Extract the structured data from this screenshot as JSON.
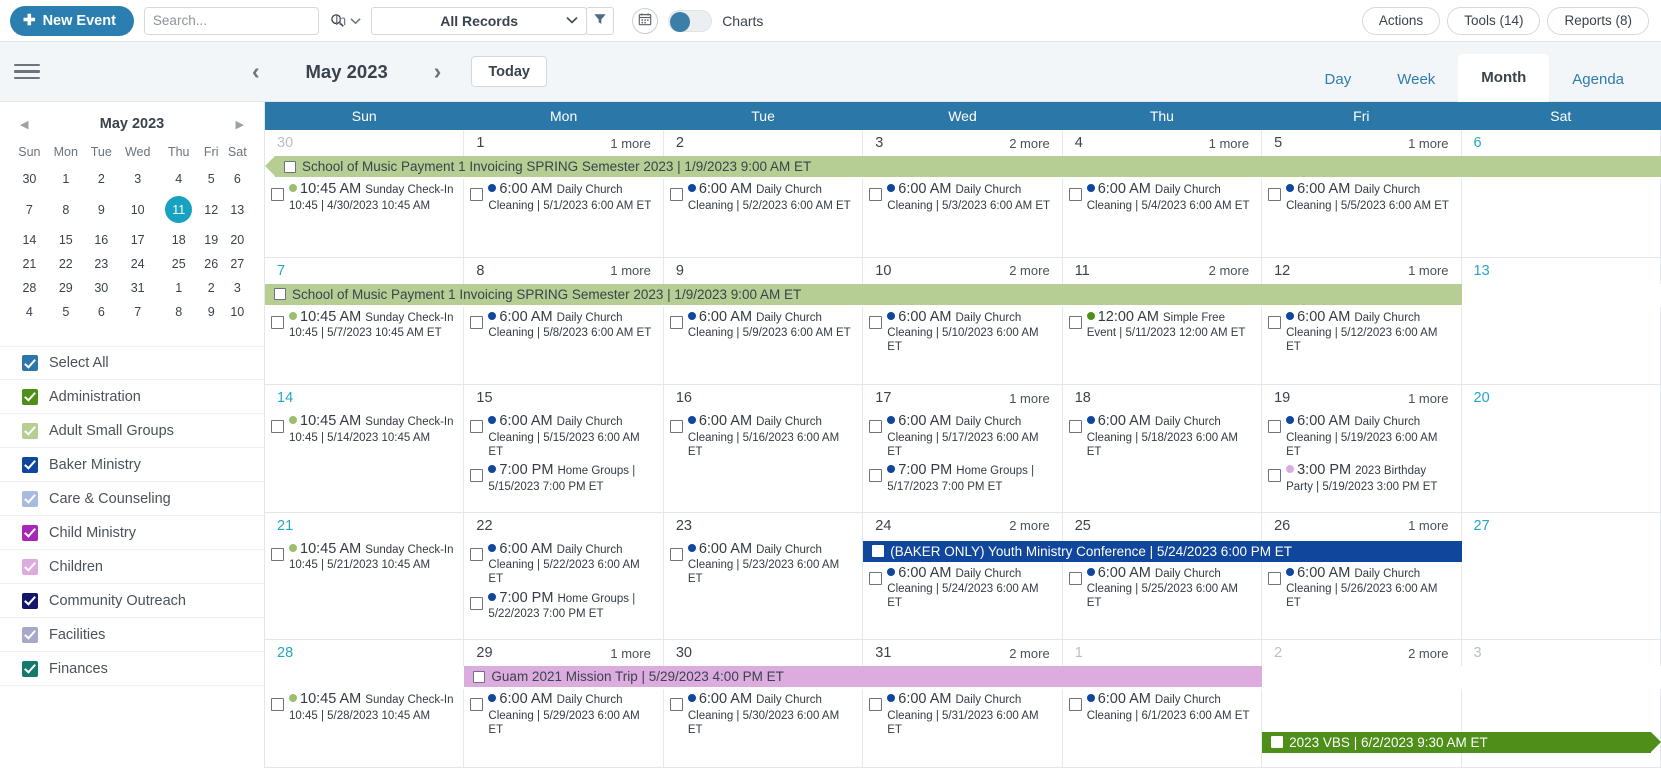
{
  "toolbar": {
    "new_event_label": "New Event",
    "search_placeholder": "Search...",
    "search_value": "",
    "in_label": "In",
    "records_label": "All Records",
    "charts_label": "Charts",
    "actions_label": "Actions",
    "tools_label": "Tools (14)",
    "reports_label": "Reports (8)"
  },
  "subbar": {
    "month_title": "May 2023",
    "today_label": "Today",
    "tabs": [
      {
        "label": "Day",
        "active": false
      },
      {
        "label": "Week",
        "active": false
      },
      {
        "label": "Month",
        "active": true
      },
      {
        "label": "Agenda",
        "active": false
      }
    ]
  },
  "mini_calendar": {
    "title": "May 2023",
    "dow": [
      "Sun",
      "Mon",
      "Tue",
      "Wed",
      "Thu",
      "Fri",
      "Sat"
    ],
    "selected": 11,
    "weeks": [
      [
        {
          "d": "30",
          "t": "muted"
        },
        {
          "d": "1",
          "t": ""
        },
        {
          "d": "2",
          "t": ""
        },
        {
          "d": "3",
          "t": ""
        },
        {
          "d": "4",
          "t": ""
        },
        {
          "d": "5",
          "t": ""
        },
        {
          "d": "6",
          "t": "wknd"
        }
      ],
      [
        {
          "d": "7",
          "t": "wknd"
        },
        {
          "d": "8",
          "t": ""
        },
        {
          "d": "9",
          "t": ""
        },
        {
          "d": "10",
          "t": ""
        },
        {
          "d": "11",
          "t": "sel"
        },
        {
          "d": "12",
          "t": ""
        },
        {
          "d": "13",
          "t": "wknd"
        }
      ],
      [
        {
          "d": "14",
          "t": "wknd"
        },
        {
          "d": "15",
          "t": ""
        },
        {
          "d": "16",
          "t": ""
        },
        {
          "d": "17",
          "t": ""
        },
        {
          "d": "18",
          "t": ""
        },
        {
          "d": "19",
          "t": ""
        },
        {
          "d": "20",
          "t": "wknd"
        }
      ],
      [
        {
          "d": "21",
          "t": "wknd"
        },
        {
          "d": "22",
          "t": ""
        },
        {
          "d": "23",
          "t": ""
        },
        {
          "d": "24",
          "t": ""
        },
        {
          "d": "25",
          "t": ""
        },
        {
          "d": "26",
          "t": ""
        },
        {
          "d": "27",
          "t": "wknd"
        }
      ],
      [
        {
          "d": "28",
          "t": "wknd"
        },
        {
          "d": "29",
          "t": ""
        },
        {
          "d": "30",
          "t": ""
        },
        {
          "d": "31",
          "t": ""
        },
        {
          "d": "1",
          "t": "muted"
        },
        {
          "d": "2",
          "t": "muted"
        },
        {
          "d": "3",
          "t": "muted"
        }
      ],
      [
        {
          "d": "4",
          "t": "muted"
        },
        {
          "d": "5",
          "t": "muted"
        },
        {
          "d": "6",
          "t": "muted"
        },
        {
          "d": "7",
          "t": "muted"
        },
        {
          "d": "8",
          "t": "muted"
        },
        {
          "d": "9",
          "t": "muted"
        },
        {
          "d": "10",
          "t": "muted"
        }
      ]
    ]
  },
  "filters": [
    {
      "label": "Select All",
      "color": "#2b78a8"
    },
    {
      "label": "Administration",
      "color": "#4d8f18"
    },
    {
      "label": "Adult Small Groups",
      "color": "#b6ce93"
    },
    {
      "label": "Baker Ministry",
      "color": "#10469b"
    },
    {
      "label": "Care & Counseling",
      "color": "#a7bcdf"
    },
    {
      "label": "Child Ministry",
      "color": "#a927b7"
    },
    {
      "label": "Children",
      "color": "#dcacdf"
    },
    {
      "label": "Community Outreach",
      "color": "#13166b"
    },
    {
      "label": "Facilities",
      "color": "#a8a8cb"
    },
    {
      "label": "Finances",
      "color": "#137a6c"
    }
  ],
  "calendar": {
    "dow": [
      "Sun",
      "Mon",
      "Tue",
      "Wed",
      "Thu",
      "Fri",
      "Sat"
    ],
    "colors": {
      "green_bar": "#b6ce93",
      "blue_bar": "#10469b",
      "pink_bar": "#dcacdf",
      "vbs_green": "#4d8f18",
      "blue_dot": "#10469b",
      "green_dot": "#9bbf6e",
      "olive_dot": "#4d8f18",
      "pink_dot": "#dcacdf"
    },
    "weeks": [
      {
        "days": [
          {
            "num": "30",
            "style": "mut",
            "more": ""
          },
          {
            "num": "1",
            "style": "",
            "more": "1 more"
          },
          {
            "num": "2",
            "style": "",
            "more": ""
          },
          {
            "num": "3",
            "style": "",
            "more": "2 more"
          },
          {
            "num": "4",
            "style": "",
            "more": "1 more"
          },
          {
            "num": "5",
            "style": "",
            "more": "1 more"
          },
          {
            "num": "6",
            "style": "wk",
            "more": ""
          }
        ],
        "bars": [
          {
            "label": "School of Music Payment 1 Invoicing SPRING Semester 2023 | 1/9/2023 9:00 AM ET",
            "start": 0,
            "end": 6,
            "color": "#b6ce93",
            "text": "#3a434d",
            "arrow_left": true,
            "arrow_right": false,
            "top": 0
          }
        ],
        "bars_height": 23,
        "events": [
          [
            {
              "time": "10:45 AM",
              "title": "Sunday Check-In 10:45 | 4/30/2023 10:45 AM",
              "dot": "#9bbf6e"
            }
          ],
          [
            {
              "time": "6:00 AM",
              "title": "Daily Church Cleaning | 5/1/2023 6:00 AM ET",
              "dot": "#10469b"
            }
          ],
          [
            {
              "time": "6:00 AM",
              "title": "Daily Church Cleaning | 5/2/2023 6:00 AM ET",
              "dot": "#10469b"
            }
          ],
          [
            {
              "time": "6:00 AM",
              "title": "Daily Church Cleaning | 5/3/2023 6:00 AM ET",
              "dot": "#10469b"
            }
          ],
          [
            {
              "time": "6:00 AM",
              "title": "Daily Church Cleaning | 5/4/2023 6:00 AM ET",
              "dot": "#10469b"
            }
          ],
          [
            {
              "time": "6:00 AM",
              "title": "Daily Church Cleaning | 5/5/2023 6:00 AM ET",
              "dot": "#10469b"
            }
          ],
          []
        ]
      },
      {
        "days": [
          {
            "num": "7",
            "style": "wk",
            "more": ""
          },
          {
            "num": "8",
            "style": "",
            "more": "1 more"
          },
          {
            "num": "9",
            "style": "",
            "more": ""
          },
          {
            "num": "10",
            "style": "",
            "more": "2 more"
          },
          {
            "num": "11",
            "style": "",
            "more": "2 more"
          },
          {
            "num": "12",
            "style": "",
            "more": "1 more"
          },
          {
            "num": "13",
            "style": "wk",
            "more": ""
          }
        ],
        "bars": [
          {
            "label": "School of Music Payment 1 Invoicing SPRING Semester 2023 | 1/9/2023 9:00 AM ET",
            "start": 0,
            "end": 5,
            "color": "#b6ce93",
            "text": "#3a434d",
            "arrow_left": false,
            "arrow_right": false,
            "top": 0
          }
        ],
        "bars_height": 23,
        "events": [
          [
            {
              "time": "10:45 AM",
              "title": "Sunday Check-In 10:45 | 5/7/2023 10:45 AM ET",
              "dot": "#9bbf6e"
            }
          ],
          [
            {
              "time": "6:00 AM",
              "title": "Daily Church Cleaning | 5/8/2023 6:00 AM ET",
              "dot": "#10469b"
            }
          ],
          [
            {
              "time": "6:00 AM",
              "title": "Daily Church Cleaning | 5/9/2023 6:00 AM ET",
              "dot": "#10469b"
            }
          ],
          [
            {
              "time": "6:00 AM",
              "title": "Daily Church Cleaning | 5/10/2023 6:00 AM ET",
              "dot": "#10469b"
            }
          ],
          [
            {
              "time": "12:00 AM",
              "title": "Simple Free Event | 5/11/2023 12:00 AM ET",
              "dot": "#4d8f18"
            }
          ],
          [
            {
              "time": "6:00 AM",
              "title": "Daily Church Cleaning | 5/12/2023 6:00 AM ET",
              "dot": "#10469b"
            }
          ],
          []
        ]
      },
      {
        "days": [
          {
            "num": "14",
            "style": "wk",
            "more": ""
          },
          {
            "num": "15",
            "style": "",
            "more": ""
          },
          {
            "num": "16",
            "style": "",
            "more": ""
          },
          {
            "num": "17",
            "style": "",
            "more": "1 more"
          },
          {
            "num": "18",
            "style": "",
            "more": ""
          },
          {
            "num": "19",
            "style": "",
            "more": "1 more"
          },
          {
            "num": "20",
            "style": "wk",
            "more": ""
          }
        ],
        "bars": [],
        "bars_height": 0,
        "events": [
          [
            {
              "time": "10:45 AM",
              "title": "Sunday Check-In 10:45 | 5/14/2023 10:45 AM",
              "dot": "#9bbf6e"
            }
          ],
          [
            {
              "time": "6:00 AM",
              "title": "Daily Church Cleaning | 5/15/2023 6:00 AM ET",
              "dot": "#10469b"
            },
            {
              "time": "7:00 PM",
              "title": "Home Groups | 5/15/2023 7:00 PM ET",
              "dot": "#10469b"
            }
          ],
          [
            {
              "time": "6:00 AM",
              "title": "Daily Church Cleaning | 5/16/2023 6:00 AM ET",
              "dot": "#10469b"
            }
          ],
          [
            {
              "time": "6:00 AM",
              "title": "Daily Church Cleaning | 5/17/2023 6:00 AM ET",
              "dot": "#10469b"
            },
            {
              "time": "7:00 PM",
              "title": "Home Groups | 5/17/2023 7:00 PM ET",
              "dot": "#10469b"
            }
          ],
          [
            {
              "time": "6:00 AM",
              "title": "Daily Church Cleaning | 5/18/2023 6:00 AM ET",
              "dot": "#10469b"
            }
          ],
          [
            {
              "time": "6:00 AM",
              "title": "Daily Church Cleaning | 5/19/2023 6:00 AM ET",
              "dot": "#10469b"
            },
            {
              "time": "3:00 PM",
              "title": "2023 Birthday Party | 5/19/2023 3:00 PM ET",
              "dot": "#dcacdf"
            }
          ],
          []
        ]
      },
      {
        "days": [
          {
            "num": "21",
            "style": "wk",
            "more": ""
          },
          {
            "num": "22",
            "style": "",
            "more": ""
          },
          {
            "num": "23",
            "style": "",
            "more": ""
          },
          {
            "num": "24",
            "style": "",
            "more": "2 more"
          },
          {
            "num": "25",
            "style": "",
            "more": ""
          },
          {
            "num": "26",
            "style": "",
            "more": "1 more"
          },
          {
            "num": "27",
            "style": "wk",
            "more": ""
          }
        ],
        "bars": [
          {
            "label": "(BAKER ONLY) Youth Ministry Conference | 5/24/2023 6:00 PM ET",
            "start": 3,
            "end": 5,
            "color": "#10469b",
            "text": "#ffffff",
            "arrow_left": false,
            "arrow_right": false,
            "top": 0
          }
        ],
        "bars_height": 0,
        "events": [
          [
            {
              "time": "10:45 AM",
              "title": "Sunday Check-In 10:45 | 5/21/2023 10:45 AM",
              "dot": "#9bbf6e"
            }
          ],
          [
            {
              "time": "6:00 AM",
              "title": "Daily Church Cleaning | 5/22/2023 6:00 AM ET",
              "dot": "#10469b"
            },
            {
              "time": "7:00 PM",
              "title": "Home Groups | 5/22/2023 7:00 PM ET",
              "dot": "#10469b"
            }
          ],
          [
            {
              "time": "6:00 AM",
              "title": "Daily Church Cleaning | 5/23/2023 6:00 AM ET",
              "dot": "#10469b"
            }
          ],
          [
            {
              "spacer": true
            },
            {
              "time": "6:00 AM",
              "title": "Daily Church Cleaning | 5/24/2023 6:00 AM ET",
              "dot": "#10469b"
            }
          ],
          [
            {
              "spacer": true
            },
            {
              "time": "6:00 AM",
              "title": "Daily Church Cleaning | 5/25/2023 6:00 AM ET",
              "dot": "#10469b"
            }
          ],
          [
            {
              "spacer": true
            },
            {
              "time": "6:00 AM",
              "title": "Daily Church Cleaning | 5/26/2023 6:00 AM ET",
              "dot": "#10469b"
            }
          ],
          []
        ]
      },
      {
        "days": [
          {
            "num": "28",
            "style": "wk",
            "more": ""
          },
          {
            "num": "29",
            "style": "",
            "more": "1 more"
          },
          {
            "num": "30",
            "style": "",
            "more": ""
          },
          {
            "num": "31",
            "style": "",
            "more": "2 more"
          },
          {
            "num": "1",
            "style": "mut",
            "more": ""
          },
          {
            "num": "2",
            "style": "mut",
            "more": "2 more"
          },
          {
            "num": "3",
            "style": "mut",
            "more": ""
          }
        ],
        "bars": [
          {
            "label": "Guam 2021 Mission Trip | 5/29/2023 4:00 PM ET",
            "start": 1,
            "end": 4,
            "color": "#dcacdf",
            "text": "#3a434d",
            "arrow_left": false,
            "arrow_right": false,
            "top": 0
          }
        ],
        "bars_height": 23,
        "events": [
          [
            {
              "time": "10:45 AM",
              "title": "Sunday Check-In 10:45 | 5/28/2023 10:45 AM",
              "dot": "#9bbf6e"
            }
          ],
          [
            {
              "time": "6:00 AM",
              "title": "Daily Church Cleaning | 5/29/2023 6:00 AM ET",
              "dot": "#10469b"
            }
          ],
          [
            {
              "time": "6:00 AM",
              "title": "Daily Church Cleaning | 5/30/2023 6:00 AM ET",
              "dot": "#10469b"
            }
          ],
          [
            {
              "time": "6:00 AM",
              "title": "Daily Church Cleaning | 5/31/2023 6:00 AM ET",
              "dot": "#10469b"
            }
          ],
          [
            {
              "time": "6:00 AM",
              "title": "Daily Church Cleaning | 6/1/2023 6:00 AM ET",
              "dot": "#10469b"
            }
          ],
          [],
          []
        ],
        "bars2": [
          {
            "label": "2023 VBS | 6/2/2023 9:30 AM ET",
            "start": 5,
            "end": 6,
            "color": "#4d8f18",
            "text": "#ffffff",
            "arrow_left": false,
            "arrow_right": true,
            "top": 0
          }
        ]
      }
    ]
  }
}
